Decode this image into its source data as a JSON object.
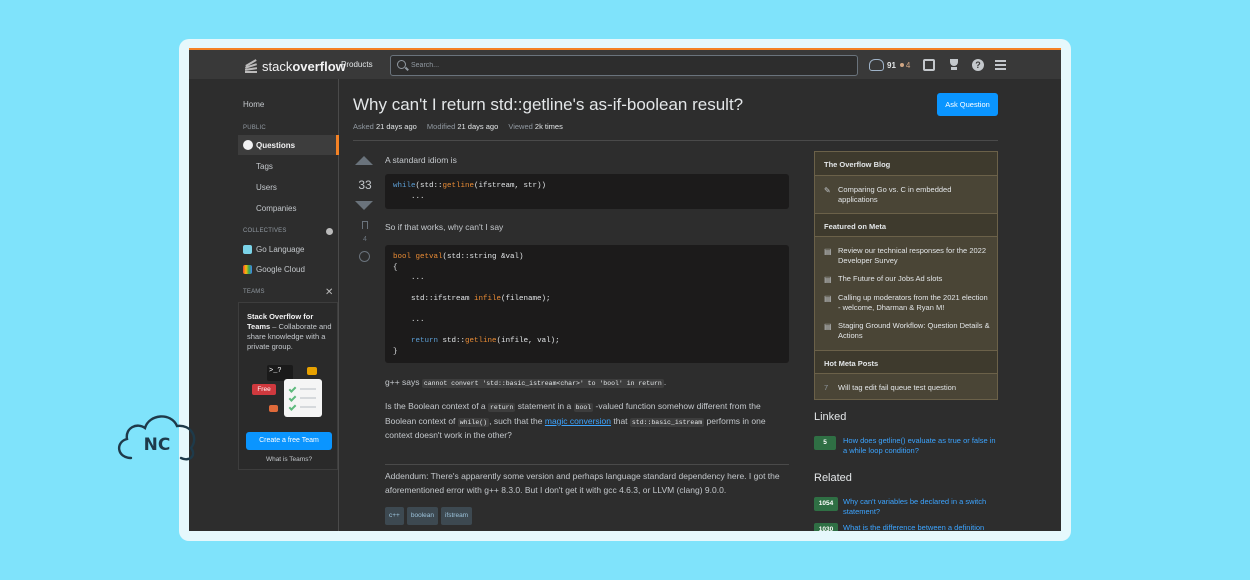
{
  "header": {
    "logo_left": "stack",
    "logo_right": "overflow",
    "products": "Products",
    "search_placeholder": "Search...",
    "reputation": "91",
    "bronze_badges": "4",
    "icons": [
      "inbox-icon",
      "trophy-icon",
      "help-icon",
      "site-switcher-icon"
    ],
    "accent_color": "#f48225"
  },
  "left_nav": {
    "home": "Home",
    "public_caption": "PUBLIC",
    "questions": "Questions",
    "tags": "Tags",
    "users": "Users",
    "companies": "Companies",
    "collectives_caption": "COLLECTIVES",
    "collectives": [
      "Go Language",
      "Google Cloud"
    ],
    "teams_caption": "TEAMS",
    "teams_title": "Stack Overflow for Teams",
    "teams_desc": " – Collaborate and share knowledge with a private group.",
    "free_label": "Free",
    "terminal_text": ">_?",
    "create_team": "Create a free Team",
    "what_is_teams": "What is Teams?"
  },
  "question": {
    "title": "Why can't I return std::getline's as-if-boolean result?",
    "asked_label": "Asked",
    "asked_value": "21 days ago",
    "modified_label": "Modified",
    "modified_value": "21 days ago",
    "viewed_label": "Viewed",
    "viewed_value": "2k times",
    "ask_button": "Ask Question",
    "votes": "33",
    "bookmarks": "4",
    "p1": "A standard idiom is",
    "p2": "So if that works, why can't I say",
    "p3_prefix": "g++ says ",
    "p3_code": "cannot convert 'std::basic_istream<char>' to 'bool' in return",
    "p3_suffix": ".",
    "p4_a": "Is the Boolean context of a ",
    "p4_code1": "return",
    "p4_b": " statement in a ",
    "p4_code2": "bool",
    "p4_c": " -valued function somehow different from the Boolean context of ",
    "p4_code3": "while()",
    "p4_d": ", such that the ",
    "p4_link": "magic conversion",
    "p4_e": " that ",
    "p4_code4": "std::basic_istream",
    "p4_f": " performs in one context doesn't work in the other?",
    "p5": "Addendum: There's apparently some version and perhaps language standard dependency here. I got the aforementioned error with g++ 8.3.0. But I don't get it with gcc 4.6.3, or LLVM (clang) 9.0.0.",
    "tags": [
      "c++",
      "boolean",
      "ifstream"
    ]
  },
  "sidebar": {
    "blog_title": "The Overflow Blog",
    "blog_items": [
      "Comparing Go vs. C in embedded applications"
    ],
    "meta_title": "Featured on Meta",
    "meta_items": [
      "Review our technical responses for the 2022 Developer Survey",
      "The Future of our Jobs Ad slots",
      "Calling up moderators from the 2021 election - welcome, Dharman & Ryan M!",
      "Staging Ground Workflow: Question Details & Actions"
    ],
    "hot_title": "Hot Meta Posts",
    "hot_items": [
      {
        "count": "7",
        "text": "Will tag edit fail queue test question"
      }
    ],
    "linked_title": "Linked",
    "linked": [
      {
        "score": "5",
        "text": "How does getline() evaluate as true or false in a while loop condition?"
      }
    ],
    "related_title": "Related",
    "related": [
      {
        "score": "1054",
        "text": "Why can't variables be declared in a switch statement?"
      },
      {
        "score": "1030",
        "text": "What is the difference between a definition and a declaration?"
      }
    ]
  },
  "watermark": "NC"
}
